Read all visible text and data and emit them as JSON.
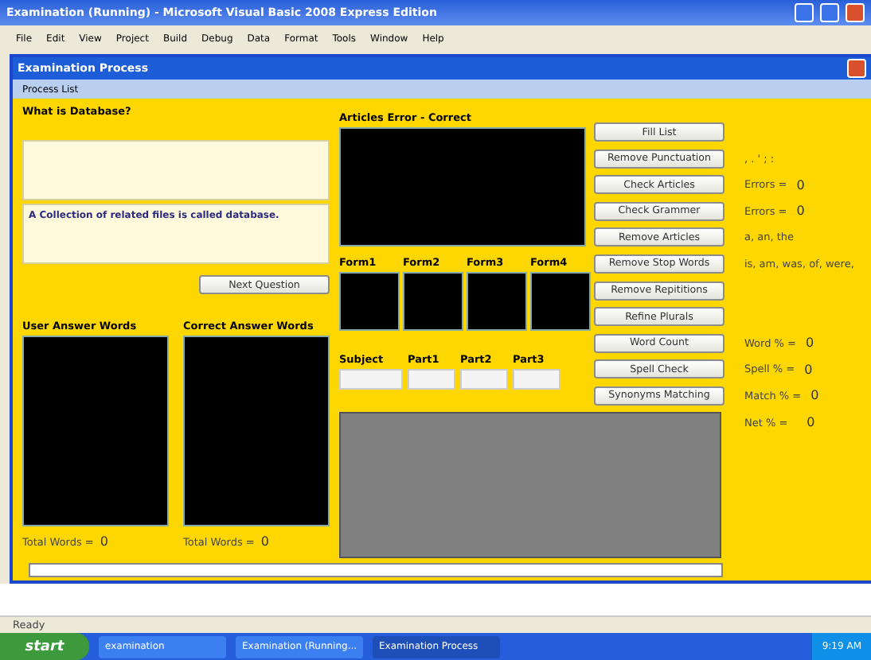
{
  "ide_window": {
    "title": "Examination (Running) - Microsoft Visual Basic 2008 Express Edition",
    "menu": [
      "File",
      "Edit",
      "View",
      "Project",
      "Build",
      "Debug",
      "Data",
      "Format",
      "Tools",
      "Window",
      "Help"
    ]
  },
  "form": {
    "title": "Examination Process",
    "menu": [
      "Process List"
    ],
    "question_label": "What is Database?",
    "answer_text": "A Collection of related files is called database.",
    "next_button": "Next Question",
    "word_lists": [
      {
        "label": "User Answer Words",
        "total_label": "Total Words =",
        "total": "0"
      },
      {
        "label": "Correct Answer Words",
        "total_label": "Total Words =",
        "total": "0"
      }
    ],
    "articles_label": "Articles Error - Correct",
    "forms": [
      "Form1",
      "Form2",
      "Form3",
      "Form4"
    ],
    "parts": [
      "Subject",
      "Part1",
      "Part2",
      "Part3"
    ],
    "actions": [
      {
        "label": "Fill List"
      },
      {
        "label": "Remove Punctuation",
        "info_label": ", . ' ; :"
      },
      {
        "label": "Check Articles",
        "info_label": "Errors =",
        "info_value": "0"
      },
      {
        "label": "Check Grammer",
        "info_label": "Errors =",
        "info_value": "0"
      },
      {
        "label": "Remove Articles",
        "info_label": "a, an, the"
      },
      {
        "label": "Remove Stop Words",
        "info_label": "is, am, was, of, were,"
      },
      {
        "label": "Remove Repititions"
      },
      {
        "label": "Refine Plurals"
      },
      {
        "label": "Word Count",
        "info_label": "Word % =",
        "info_value": "0"
      },
      {
        "label": "Spell Check",
        "info_label": "Spell % =",
        "info_value": "0"
      },
      {
        "label": "Synonyms Matching",
        "info_label": "Match % =",
        "info_value": "0"
      }
    ],
    "net": {
      "label": "Net % =",
      "value": "0"
    }
  },
  "status_bar": "Ready",
  "taskbar": {
    "start": "start",
    "tasks": [
      {
        "label": "examination",
        "selected": false
      },
      {
        "label": "Examination (Running...",
        "selected": false
      },
      {
        "label": "Examination Process",
        "selected": true
      }
    ],
    "clock": "9:19 AM"
  }
}
